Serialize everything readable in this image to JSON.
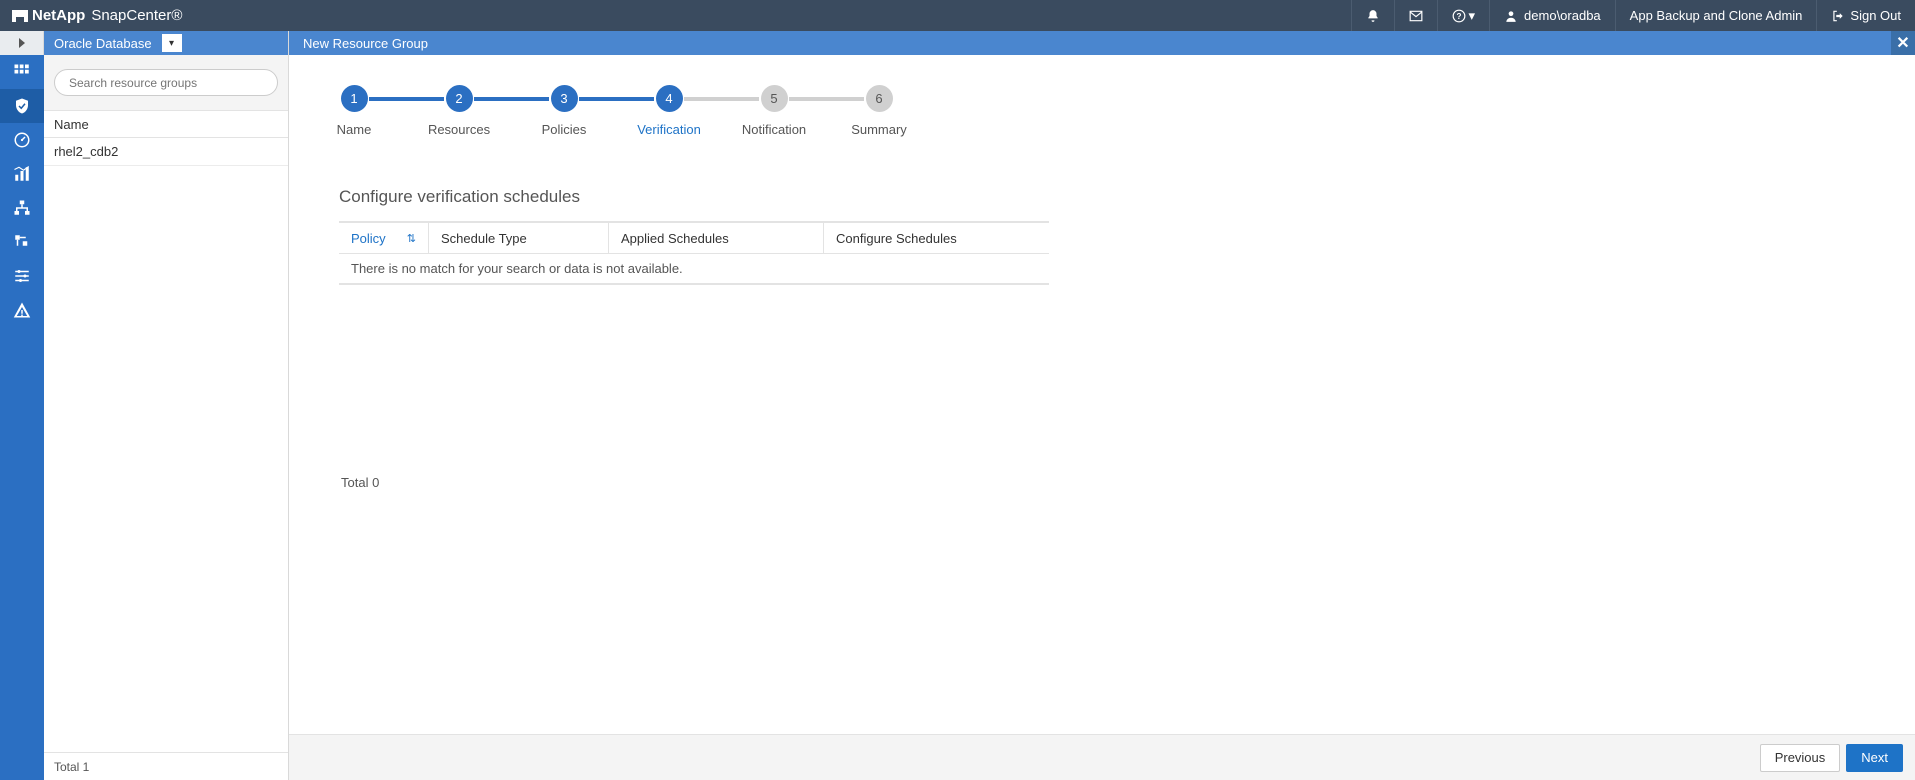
{
  "brand": {
    "vendor": "NetApp",
    "product": "SnapCenter®"
  },
  "topbar": {
    "user": "demo\\oradba",
    "role": "App Backup and Clone Admin",
    "signout": "Sign Out"
  },
  "leftpanel": {
    "dropdown": "Oracle Database",
    "search_placeholder": "Search resource groups",
    "col_name": "Name",
    "rows": [
      "rhel2_cdb2"
    ],
    "total": "Total 1"
  },
  "content": {
    "title": "New Resource Group",
    "steps": [
      {
        "num": "1",
        "label": "Name",
        "state": "done"
      },
      {
        "num": "2",
        "label": "Resources",
        "state": "done"
      },
      {
        "num": "3",
        "label": "Policies",
        "state": "done"
      },
      {
        "num": "4",
        "label": "Verification",
        "state": "current"
      },
      {
        "num": "5",
        "label": "Notification",
        "state": "pending"
      },
      {
        "num": "6",
        "label": "Summary",
        "state": "pending"
      }
    ],
    "section_title": "Configure verification schedules",
    "table": {
      "headers": {
        "policy": "Policy",
        "type": "Schedule Type",
        "applied": "Applied Schedules",
        "configure": "Configure Schedules"
      },
      "empty": "There is no match for your search or data is not available.",
      "total": "Total 0"
    },
    "buttons": {
      "previous": "Previous",
      "next": "Next"
    }
  }
}
